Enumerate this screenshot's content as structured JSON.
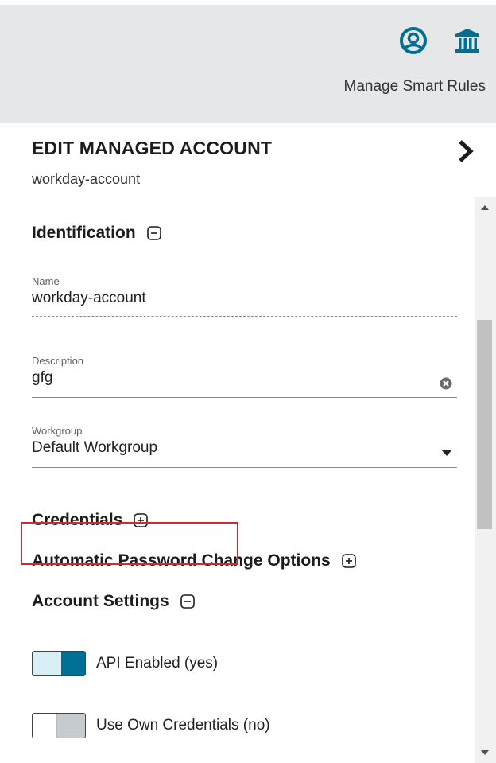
{
  "header": {
    "user_icon": "user-circle-icon",
    "bank_icon": "institution-icon",
    "smart_rules_link": "Manage Smart Rules",
    "accent_color": "#006f94"
  },
  "panel": {
    "title": "EDIT MANAGED ACCOUNT",
    "subtitle": "workday-account",
    "close_icon": "chevron-right-icon"
  },
  "identification": {
    "title": "Identification",
    "expanded": true,
    "name_label": "Name",
    "name_value": "workday-account",
    "description_label": "Description",
    "description_value": "gfg",
    "workgroup_label": "Workgroup",
    "workgroup_value": "Default Workgroup"
  },
  "sections": {
    "credentials": "Credentials",
    "auto_password": "Automatic Password Change Options",
    "account_settings": "Account Settings"
  },
  "account_settings": {
    "api_enabled_label": "API Enabled (yes)",
    "api_enabled": true,
    "use_own_credentials_label": "Use Own Credentials (no)",
    "use_own_credentials": false
  },
  "colors": {
    "highlight": "#d7262d",
    "toggle_on": "#006f94"
  }
}
